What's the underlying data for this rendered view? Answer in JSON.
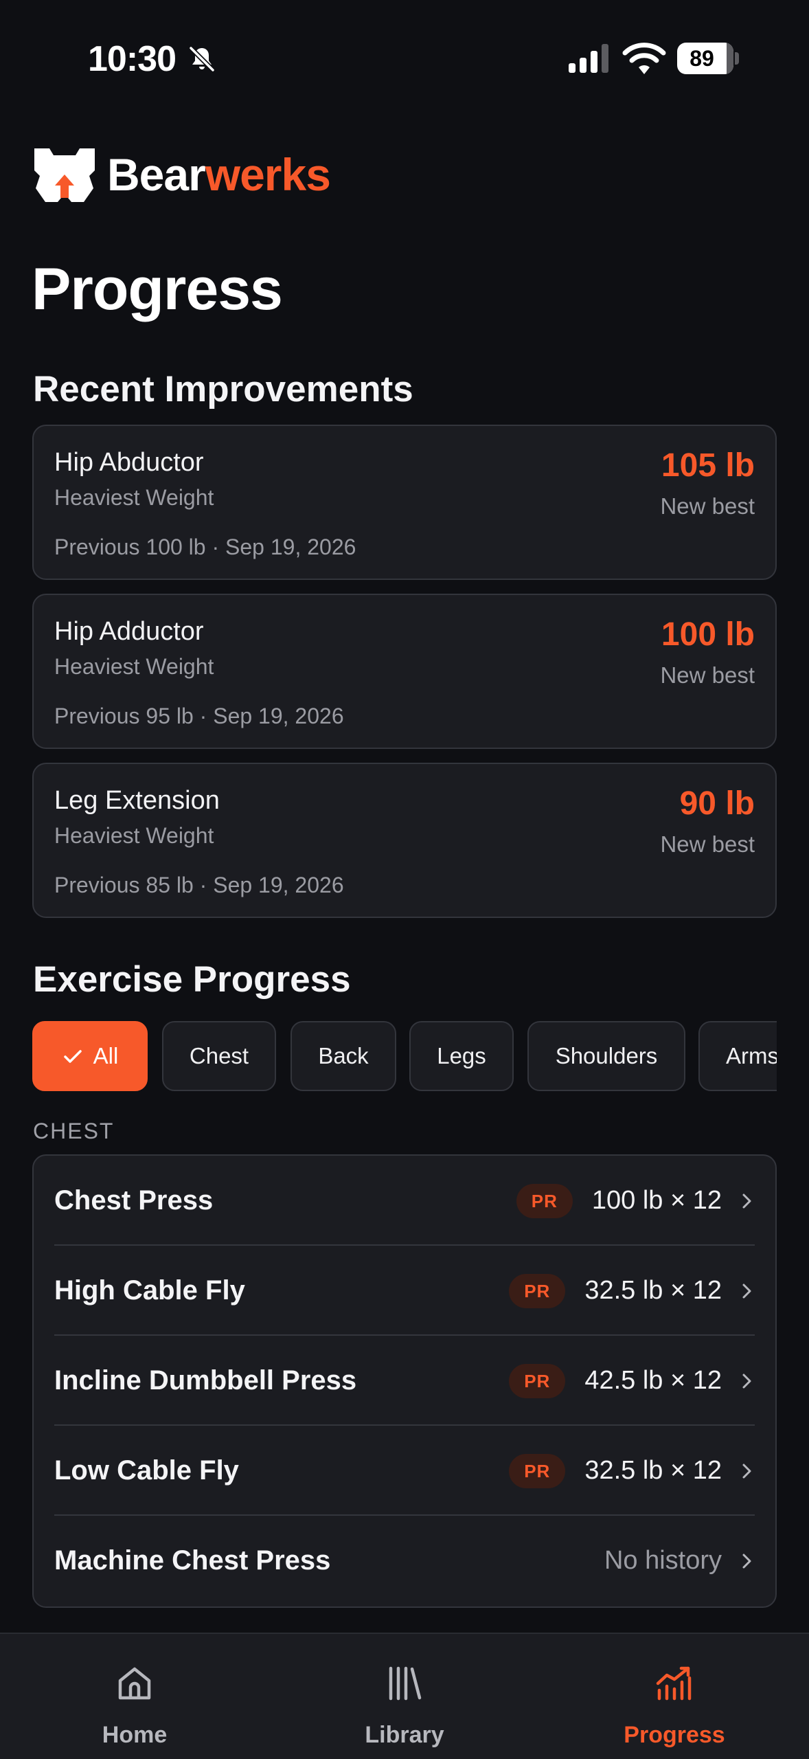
{
  "status_bar": {
    "time": "10:30",
    "battery": "89",
    "icons": [
      "bell-slash-icon",
      "cellular-signal-icon",
      "wifi-icon",
      "battery-icon"
    ]
  },
  "brand": {
    "name_part1": "Bear",
    "name_part2": "werks",
    "logo": "bear-logo-icon",
    "accent_color": "#f7592a"
  },
  "page_title": "Progress",
  "recent": {
    "title": "Recent Improvements",
    "items": [
      {
        "name": "Hip Abductor",
        "metric": "Heaviest Weight",
        "previous": "Previous 100 lb · Sep 19, 2026",
        "value": "105 lb",
        "badge": "New best"
      },
      {
        "name": "Hip Adductor",
        "metric": "Heaviest Weight",
        "previous": "Previous 95 lb · Sep 19, 2026",
        "value": "100 lb",
        "badge": "New best"
      },
      {
        "name": "Leg Extension",
        "metric": "Heaviest Weight",
        "previous": "Previous 85 lb · Sep 19, 2026",
        "value": "90 lb",
        "badge": "New best"
      }
    ]
  },
  "exercise_progress": {
    "title": "Exercise Progress",
    "filters": [
      "All",
      "Chest",
      "Back",
      "Legs",
      "Shoulders",
      "Arms"
    ],
    "selected_filter": "All",
    "group_label": "CHEST",
    "pr_label": "PR",
    "exercises": [
      {
        "name": "Chest Press",
        "value": "100 lb × 12",
        "pr": true
      },
      {
        "name": "High Cable Fly",
        "value": "32.5 lb × 12",
        "pr": true
      },
      {
        "name": "Incline Dumbbell Press",
        "value": "42.5 lb × 12",
        "pr": true
      },
      {
        "name": "Low Cable Fly",
        "value": "32.5 lb × 12",
        "pr": true
      },
      {
        "name": "Machine Chest Press",
        "value": "No history",
        "pr": false
      }
    ]
  },
  "bottom_nav": {
    "items": [
      {
        "label": "Home",
        "icon": "home-icon"
      },
      {
        "label": "Library",
        "icon": "library-icon"
      },
      {
        "label": "Progress",
        "icon": "chart-icon"
      }
    ],
    "active": "Progress"
  }
}
